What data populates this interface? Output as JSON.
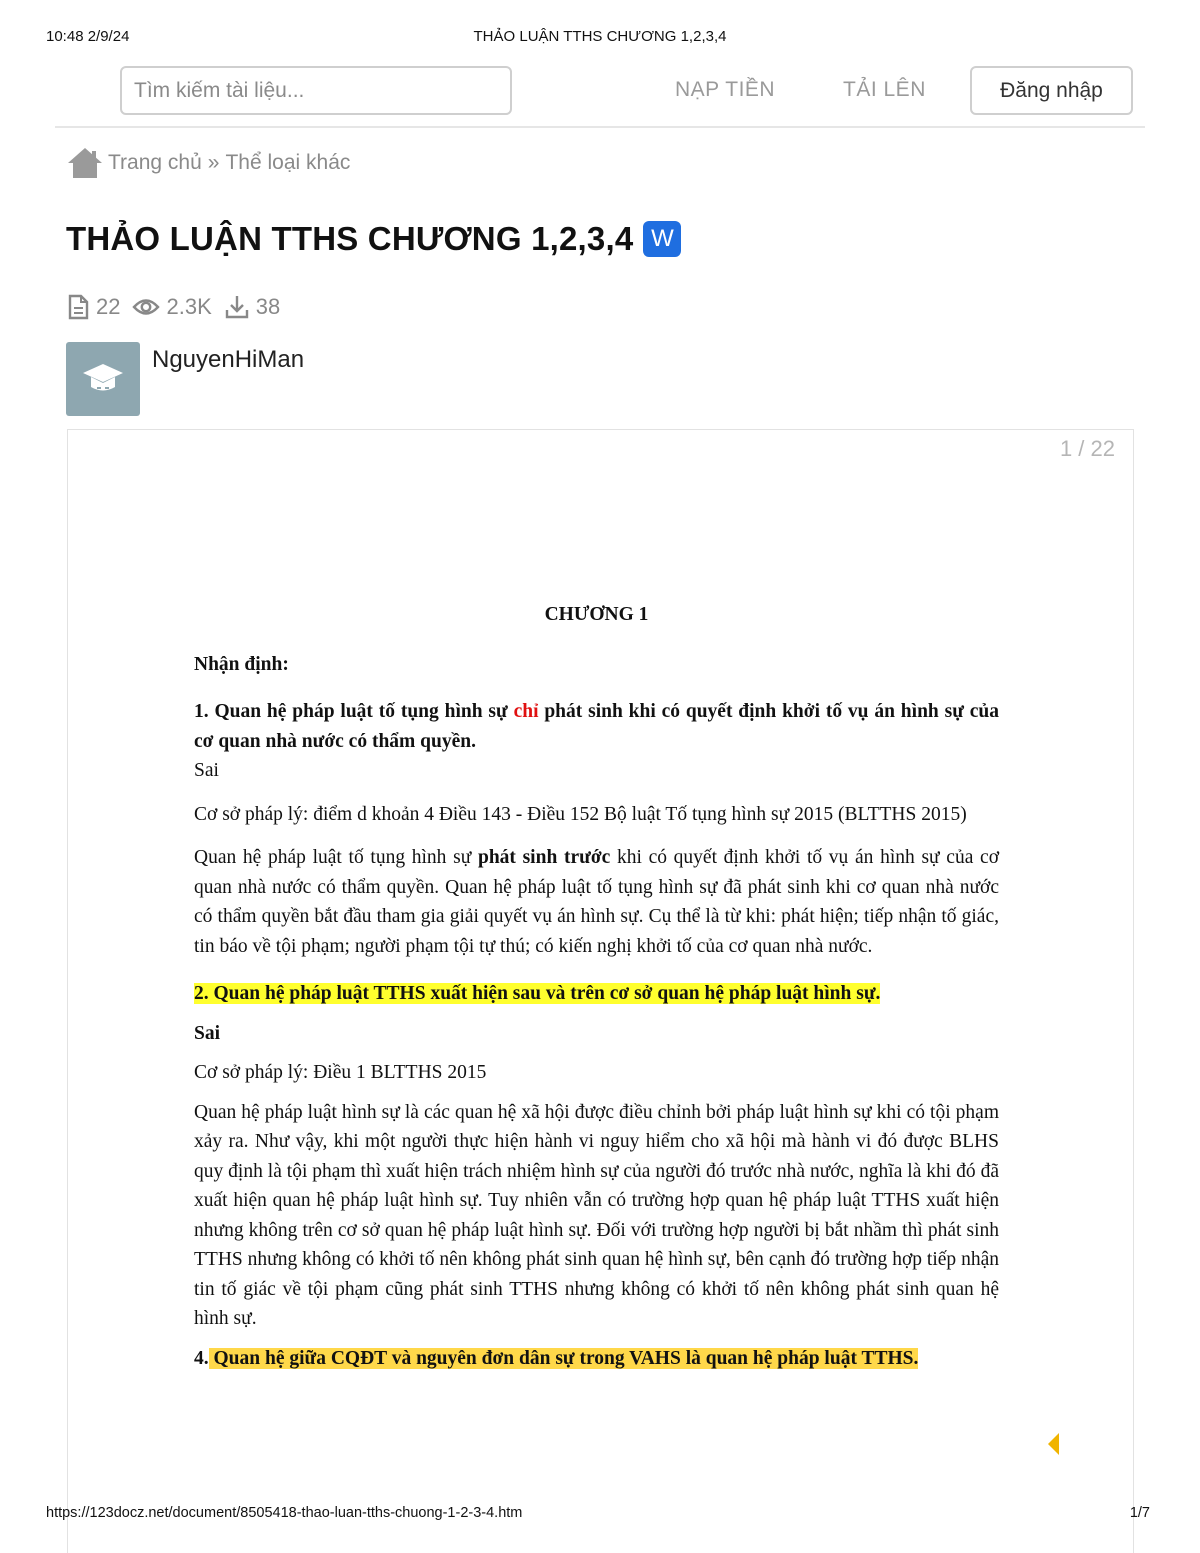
{
  "print": {
    "timestamp": "10:48 2/9/24",
    "title": "THẢO LUẬN TTHS CHƯƠNG 1,2,3,4",
    "url": "https://123docz.net/document/8505418-thao-luan-tths-chuong-1-2-3-4.htm",
    "page": "1/7"
  },
  "header": {
    "search_placeholder": "Tìm kiếm tài liệu...",
    "nap_tien": "NẠP TIỀN",
    "tai_len": "TẢI LÊN",
    "login": "Đăng nhập"
  },
  "breadcrumb": {
    "home": "Trang chủ",
    "separator": "»",
    "category": "Thể loại khác"
  },
  "document": {
    "title": "THẢO LUẬN TTHS CHƯƠNG 1,2,3,4",
    "format_badge": "W",
    "pages": "22",
    "views": "2.3K",
    "downloads": "38",
    "author": "NguyenHiMan",
    "page_counter": "1 / 22"
  },
  "paper": {
    "chapter": "CHƯƠNG 1",
    "nhan_dinh": "Nhận định:",
    "q1_a": "1. Quan hệ pháp luật tố tụng hình sự ",
    "q1_red": "chỉ",
    "q1_b": " phát sinh khi có quyết định khởi tố vụ án hình sự của cơ quan nhà nước có thẩm quyền.",
    "q1_ans": "Sai",
    "q1_basis": "Cơ sở pháp lý: điểm d khoản 4 Điều 143 - Điều 152 Bộ luật Tố tụng hình sự 2015 (BLTTHS 2015)",
    "q1_exp_a": "Quan hệ pháp luật tố tụng hình sự ",
    "q1_exp_bold": "phát sinh trước",
    "q1_exp_b": " khi có quyết định khởi tố vụ án hình sự của cơ quan nhà nước có thẩm quyền. Quan hệ pháp luật tố tụng hình sự đã phát sinh khi cơ quan nhà nước có thẩm quyền bắt đầu tham gia giải quyết vụ án hình sự. Cụ thể là từ khi: phát hiện; tiếp nhận tố giác, tin báo về tội phạm; người phạm tội tự thú; có kiến nghị khởi tố của cơ quan nhà nước.",
    "q2": "2. Quan hệ pháp luật TTHS xuất hiện sau và trên cơ sở quan hệ pháp luật hình sự.",
    "q2_ans": "Sai",
    "q2_basis": "Cơ sở pháp lý: Điều 1 BLTTHS 2015",
    "q2_exp": "Quan hệ pháp luật hình sự là các quan hệ xã hội được điều chỉnh bởi pháp luật hình sự khi có tội phạm xảy ra. Như vậy, khi một người thực hiện hành vi nguy hiểm cho xã hội mà hành vi đó được BLHS quy định là tội phạm thì xuất hiện trách nhiệm hình sự của người đó trước nhà nước, nghĩa là khi đó đã xuất hiện quan hệ pháp luật hình sự. Tuy nhiên vẫn có trường hợp quan hệ pháp luật TTHS xuất hiện nhưng không trên cơ sở quan hệ pháp luật hình sự. Đối với trường hợp người bị bắt nhầm thì phát sinh TTHS nhưng không có khởi tố nên không phát sinh quan hệ hình sự, bên cạnh đó trường hợp tiếp nhận tin tố giác về tội phạm cũng phát sinh TTHS nhưng không có khởi tố nên không phát sinh quan hệ hình sự.",
    "q4_num": "4.",
    "q4_text": " Quan hệ giữa CQĐT và nguyên đơn dân sự trong VAHS là quan hệ pháp luật TTHS."
  },
  "colors": {
    "word_badge": "#1f6ee0",
    "highlight_yellow": "#ffff2e",
    "highlight_orange": "#ffd84a",
    "red_text": "#e01010",
    "nav_arrow": "#f0b400"
  }
}
